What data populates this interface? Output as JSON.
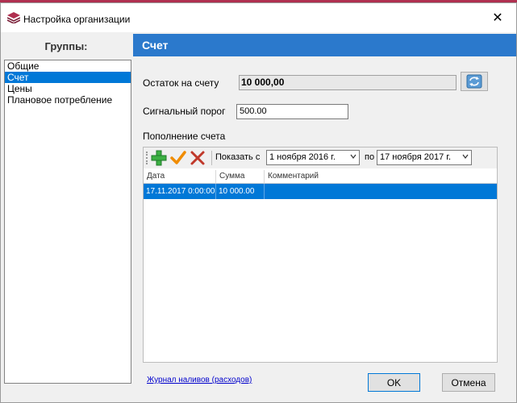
{
  "window": {
    "title": "Настройка организации",
    "close_glyph": "✕"
  },
  "groups": {
    "header": "Группы:",
    "items": [
      {
        "label": "Общие",
        "selected": false
      },
      {
        "label": "Счет",
        "selected": true
      },
      {
        "label": "Цены",
        "selected": false
      },
      {
        "label": "Плановое потребление",
        "selected": false
      }
    ]
  },
  "section": {
    "title": "Счет"
  },
  "balance": {
    "label": "Остаток на счету",
    "value": "10 000,00"
  },
  "threshold": {
    "label": "Сигнальный порог",
    "value": "500.00"
  },
  "topup": {
    "label": "Пополнение счета",
    "toolbar": {
      "add_icon": "plus-icon",
      "confirm_icon": "checkmark-icon",
      "delete_icon": "cross-icon",
      "show_from_label": "Показать с",
      "date_from": "1  ноября   2016 г.",
      "to_label": "по",
      "date_to": "17 ноября   2017 г."
    },
    "columns": [
      "Дата",
      "Сумма",
      "Комментарий"
    ],
    "rows": [
      {
        "date": "17.11.2017 0:00:00",
        "amount": "10 000.00",
        "comment": "",
        "selected": true
      }
    ]
  },
  "journal_link": "Журнал наливов (расходов)",
  "buttons": {
    "ok": "OK",
    "cancel": "Отмена"
  },
  "colors": {
    "accent": "#2b79cc",
    "selection": "#0078d7",
    "brand_stripe": "#b03050"
  }
}
